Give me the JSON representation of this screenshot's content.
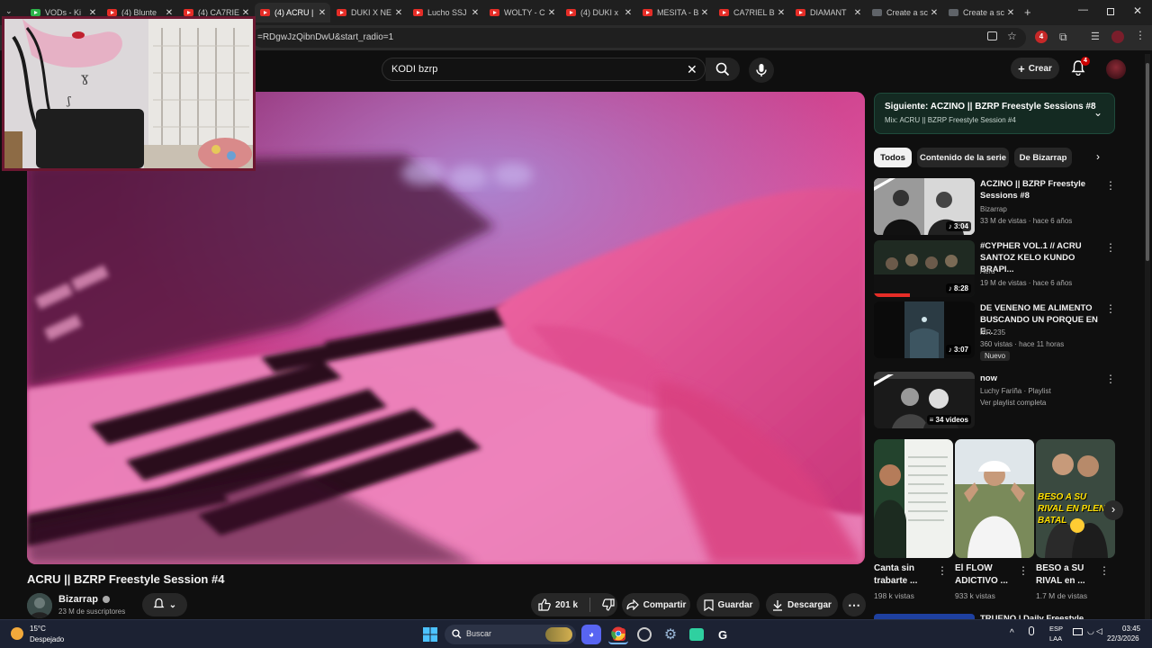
{
  "browser": {
    "tabs": [
      {
        "label": "VODs - Ki",
        "icon": "green"
      },
      {
        "label": "(4) Blunte",
        "icon": "yt"
      },
      {
        "label": "(4) CA7RIE",
        "icon": "yt"
      },
      {
        "label": "(4) ACRU |",
        "icon": "yt",
        "active": true
      },
      {
        "label": "DUKI X NE",
        "icon": "yt"
      },
      {
        "label": "Lucho SSJ",
        "icon": "yt"
      },
      {
        "label": "WOLTY - C",
        "icon": "yt"
      },
      {
        "label": "(4) DUKI x",
        "icon": "yt"
      },
      {
        "label": "MESITA - B",
        "icon": "yt"
      },
      {
        "label": "CA7RIEL B",
        "icon": "yt"
      },
      {
        "label": "DIAMANT",
        "icon": "yt"
      },
      {
        "label": "Create a sc",
        "icon": "doc"
      },
      {
        "label": "Create a sc",
        "icon": "doc"
      }
    ],
    "url": "=RDgwJzQibnDwU&start_radio=1",
    "profile_badge": "4"
  },
  "masthead": {
    "search_value": "KODI bzrp",
    "create_label": "Crear",
    "notif_count": "4"
  },
  "video": {
    "title": "ACRU || BZRP Freestyle Session #4",
    "channel": "Bizarrap",
    "subscribers": "23 M de suscriptores",
    "likes": "201 k",
    "share_label": "Compartir",
    "save_label": "Guardar",
    "download_label": "Descargar"
  },
  "up_next": {
    "title": "Siguiente: ACZINO || BZRP Freestyle Sessions #8",
    "subtitle": "Mix: ACRU || BZRP Freestyle Session #4"
  },
  "chips": [
    "Todos",
    "Contenido de la serie",
    "De Bizarrap"
  ],
  "recommendations": [
    {
      "title1": "ACZINO || BZRP Freestyle",
      "title2": "Sessions #8",
      "channel": "Bizarrap",
      "meta": "33 M de vistas · hace 6 años",
      "duration": "3:04"
    },
    {
      "title1": "#CYPHER VOL.1 // ACRU",
      "title2": "SANTOZ KELO KUNDO BRAPI...",
      "channel": "Acru",
      "meta": "19 M de vistas · hace 6 años",
      "duration": "8:28"
    },
    {
      "title1": "DE VENENO ME ALIMENTO",
      "title2": "BUSCANDO UN PORQUE EN E...",
      "channel": "MR 235",
      "meta": "360 vistas · hace 11 horas",
      "duration": "3:07",
      "badge": "Nuevo"
    },
    {
      "title1": "now",
      "title2": "",
      "channel": "Luchy Fariña · Playlist",
      "meta": "Ver playlist completa",
      "duration": "34 videos"
    }
  ],
  "shorts": [
    {
      "title1": "Canta sin",
      "title2": "trabarte ...",
      "views": "198 k vistas"
    },
    {
      "title1": "El FLOW",
      "title2": "ADICTIVO ...",
      "views": "933 k vistas"
    },
    {
      "title1": "BESO a SU",
      "title2": "RIVAL en ...",
      "views": "1.7 M de vistas",
      "overlay": "BESO A SU RIVAL EN PLENA BATAL"
    }
  ],
  "bottom_peek": "TRUENO | Daily Freestyle",
  "taskbar": {
    "weather_temp": "15°C",
    "weather_desc": "Despejado",
    "search_label": "Buscar",
    "lang1": "ESP",
    "lang2": "LAA",
    "time": "03:45",
    "date": "22/3/2026"
  },
  "colors": {
    "accent_red": "#e52d27",
    "up_next_bg": "#142a22",
    "player_tint": "#c2357a"
  }
}
